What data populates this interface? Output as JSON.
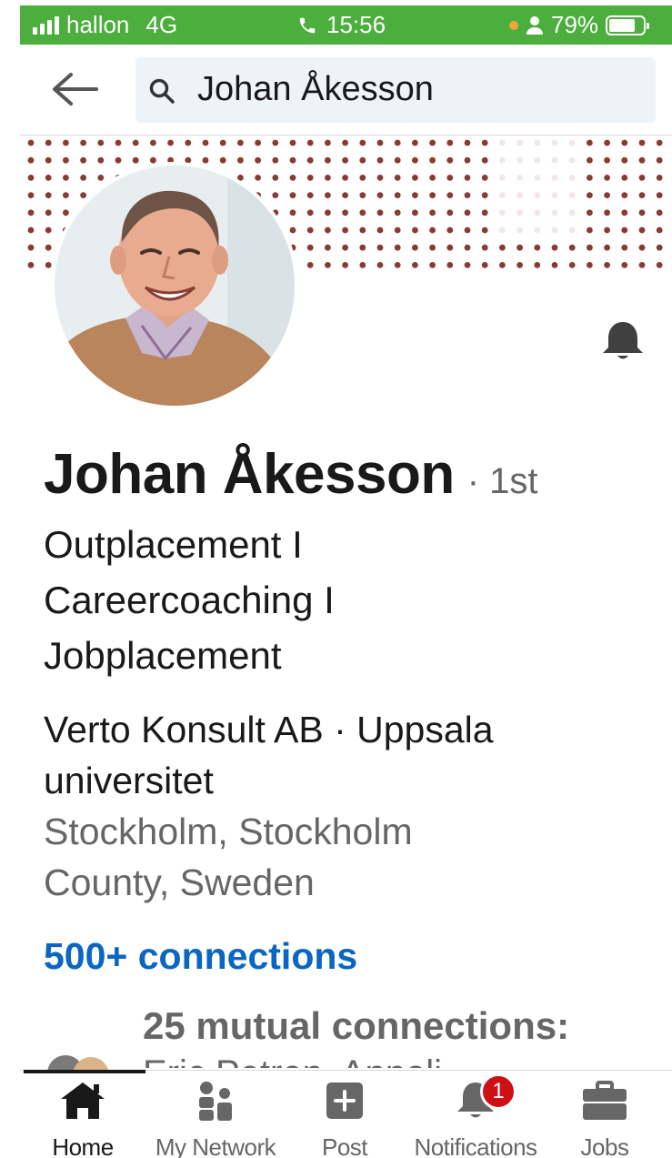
{
  "status_bar": {
    "carrier": "hallon",
    "network": "4G",
    "time": "15:56",
    "battery": "79%",
    "battery_level": 0.79,
    "colors": {
      "background": "#4cae3c",
      "dot": "#f2a43a"
    }
  },
  "search": {
    "query": "Johan Åkesson",
    "back_icon": "back-arrow-icon",
    "search_icon": "search-icon"
  },
  "profile": {
    "name": "Johan Åkesson",
    "degree": "· 1st",
    "headline_lines": [
      "Outplacement I",
      "Careercoaching I",
      "Jobplacement"
    ],
    "company_lines": [
      "Verto Konsult AB · Uppsala",
      "universitet"
    ],
    "location_lines": [
      "Stockholm, Stockholm",
      "County, Sweden"
    ],
    "connections": "500+ connections",
    "mutual_connections": "25 mutual connections:",
    "mutual_names_partial": "Eric Petren, Anneli",
    "bell_icon": "bell-icon"
  },
  "bottom_nav": {
    "items": [
      {
        "label": "Home",
        "icon": "home-icon",
        "active": true
      },
      {
        "label": "My Network",
        "icon": "people-icon",
        "active": false
      },
      {
        "label": "Post",
        "icon": "plus-square-icon",
        "active": false
      },
      {
        "label": "Notifications",
        "icon": "bell-icon",
        "active": false,
        "badge": "1"
      },
      {
        "label": "Jobs",
        "icon": "briefcase-icon",
        "active": false
      }
    ]
  },
  "colors": {
    "link": "#0a66c2",
    "badge": "#cc1016",
    "banner_dots": "#8a3a35",
    "search_bg": "#eef3f8"
  }
}
